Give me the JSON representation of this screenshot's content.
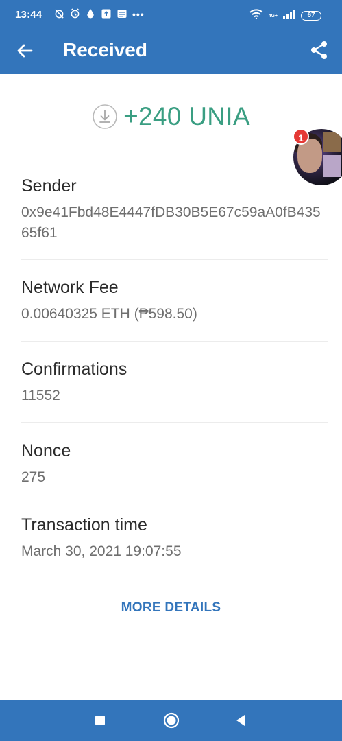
{
  "status_bar": {
    "time": "13:44",
    "network_label": "4G+",
    "battery": "67"
  },
  "app_bar": {
    "title": "Received"
  },
  "summary": {
    "amount": "+240 UNIA"
  },
  "details": {
    "sender": {
      "label": "Sender",
      "value": "0x9e41Fbd48E4447fDB30B5E67c59aA0fB43565f61"
    },
    "network_fee": {
      "label": "Network Fee",
      "value": "0.00640325 ETH (₱598.50)"
    },
    "confirmations": {
      "label": "Confirmations",
      "value": "11552"
    },
    "nonce": {
      "label": "Nonce",
      "value": "275"
    },
    "transaction_time": {
      "label": "Transaction time",
      "value": "March 30, 2021 19:07:55"
    }
  },
  "more_details_label": "MORE DETAILS",
  "chat_head": {
    "badge_count": "1"
  },
  "colors": {
    "primary": "#3375bb",
    "received_green": "#3a9e82",
    "label_text": "#2b2b2b",
    "value_text": "#6f6f6f"
  },
  "icons": {
    "back": "arrow-left-icon",
    "share": "share-icon",
    "received": "download-circle-icon",
    "nav_recents": "square-icon",
    "nav_home": "circle-icon",
    "nav_back": "triangle-left-icon"
  }
}
